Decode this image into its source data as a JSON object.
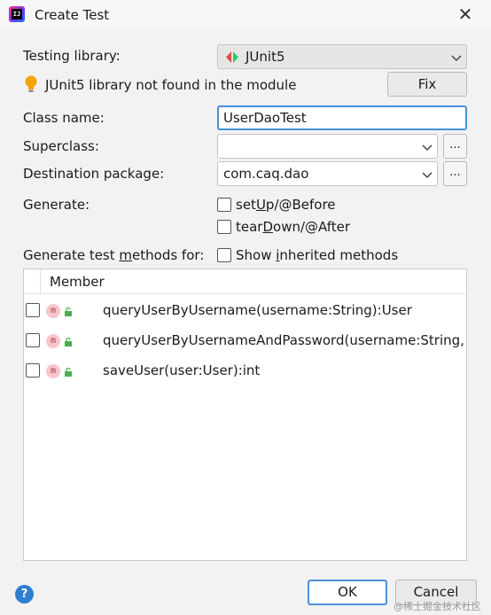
{
  "window": {
    "title": "Create Test",
    "close_glyph": "✕"
  },
  "form": {
    "testing_library_label": "Testing library:",
    "testing_library_value": "JUnit5",
    "warning_text": "JUnit5 library not found in the module",
    "fix_button": "Fix",
    "class_name_label": "Class name:",
    "class_name_value": "UserDaoTest",
    "superclass_label": "Superclass:",
    "superclass_value": "",
    "superclass_browse": "...",
    "destination_package_label": "Destination package:",
    "destination_package_value": "com.caq.dao",
    "destination_browse": "...",
    "generate_label": "Generate:",
    "setup_pre": "set",
    "setup_u": "U",
    "setup_post": "p/@Before",
    "teardown_pre": "tear",
    "teardown_u": "D",
    "teardown_post": "own/@After",
    "methods_for_pre": "Generate test ",
    "methods_for_u": "m",
    "methods_for_post": "ethods for:",
    "show_inherited_pre": "Show ",
    "show_inherited_u": "i",
    "show_inherited_post": "nherited methods"
  },
  "table": {
    "header": "Member",
    "icon_letter": "m",
    "rows": [
      {
        "signature": "queryUserByUsername(username:String):User"
      },
      {
        "signature": "queryUserByUsernameAndPassword(username:String, pa"
      },
      {
        "signature": "saveUser(user:User):int"
      }
    ]
  },
  "footer": {
    "help_glyph": "?",
    "ok_button": "OK",
    "cancel_button": "Cancel",
    "watermark": "@稀土掘金技术社区"
  },
  "colors": {
    "accent": "#4a90d9",
    "warning_bulb": "#f4a300",
    "junit_left": "#e74c3c",
    "junit_right": "#2ecc71"
  }
}
